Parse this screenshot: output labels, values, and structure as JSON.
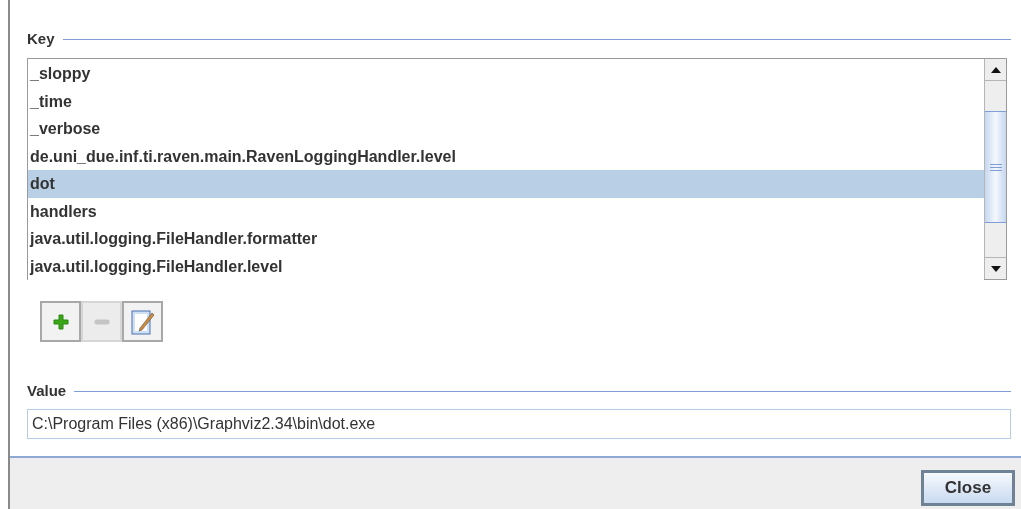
{
  "key_section": {
    "title": "Key",
    "items": [
      {
        "label": "_sloppy",
        "selected": false
      },
      {
        "label": "_time",
        "selected": false
      },
      {
        "label": "_verbose",
        "selected": false
      },
      {
        "label": "de.uni_due.inf.ti.raven.main.RavenLoggingHandler.level",
        "selected": false
      },
      {
        "label": "dot",
        "selected": true
      },
      {
        "label": "handlers",
        "selected": false
      },
      {
        "label": "java.util.logging.FileHandler.formatter",
        "selected": false
      },
      {
        "label": "java.util.logging.FileHandler.level",
        "selected": false
      }
    ],
    "tools": [
      {
        "kind": "add",
        "disabled": false
      },
      {
        "kind": "remove",
        "disabled": true
      },
      {
        "kind": "edit",
        "disabled": false
      }
    ]
  },
  "value_section": {
    "title": "Value",
    "value": "C:\\Program Files (x86)\\Graphviz2.34\\bin\\dot.exe"
  },
  "buttons": [
    {
      "label": "Close"
    }
  ]
}
